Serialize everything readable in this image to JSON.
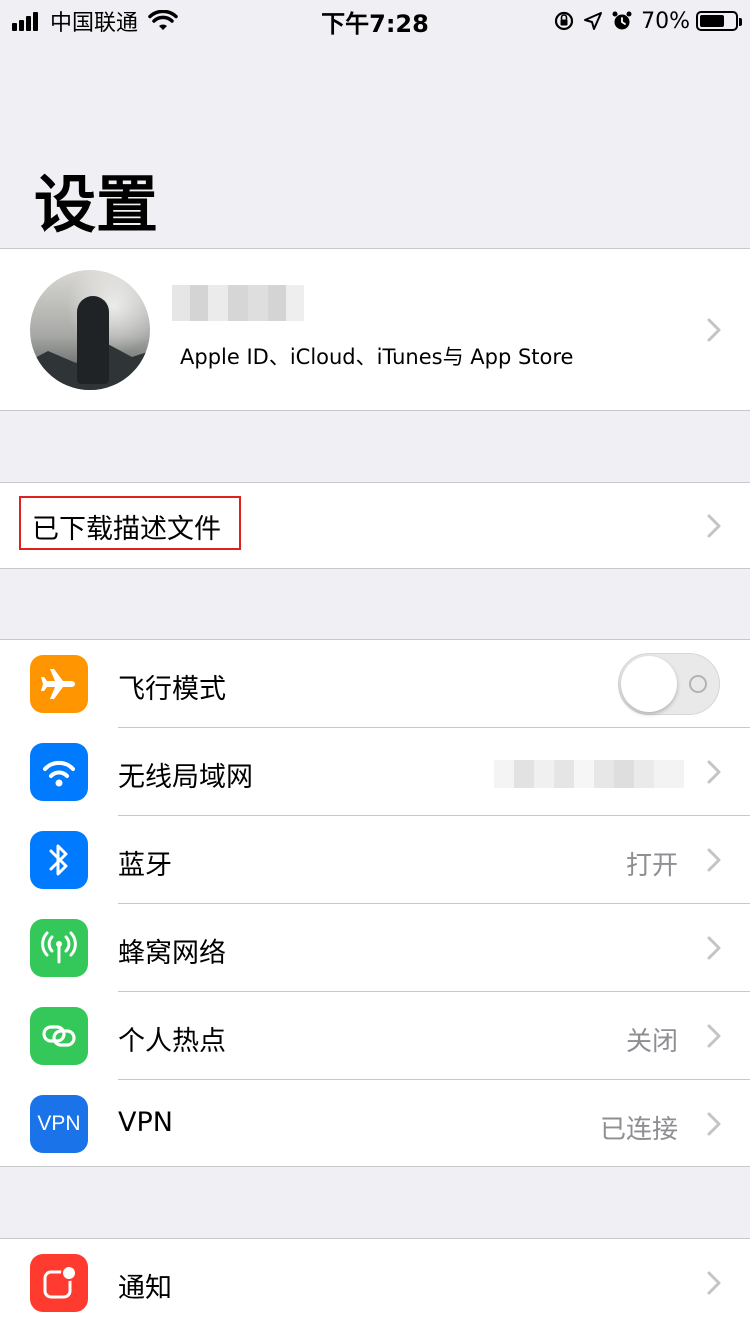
{
  "status_bar": {
    "carrier": "中国联通",
    "time": "下午7:28",
    "battery": "70%",
    "battery_level": 0.7
  },
  "page_title": "设置",
  "profile": {
    "subtitle": "Apple ID、iCloud、iTunes与 App Store"
  },
  "downloaded_profile": {
    "label": "已下载描述文件"
  },
  "settings": [
    {
      "label": "飞行模式",
      "value": "",
      "icon": "airplane-icon",
      "color": "#ff9500",
      "toggle": "off"
    },
    {
      "label": "无线局域网",
      "value": "",
      "icon": "wifi-icon",
      "color": "#007aff"
    },
    {
      "label": "蓝牙",
      "value": "打开",
      "icon": "bluetooth-icon",
      "color": "#007aff"
    },
    {
      "label": "蜂窝网络",
      "value": "",
      "icon": "cellular-icon",
      "color": "#34c759"
    },
    {
      "label": "个人热点",
      "value": "关闭",
      "icon": "hotspot-icon",
      "color": "#34c759"
    },
    {
      "label": "VPN",
      "value": "已连接",
      "icon": "vpn-icon",
      "icon_text": "VPN",
      "color": "#1a73e8"
    }
  ],
  "notifications": {
    "label": "通知",
    "icon": "notifications-icon",
    "color": "#ff3b30"
  }
}
